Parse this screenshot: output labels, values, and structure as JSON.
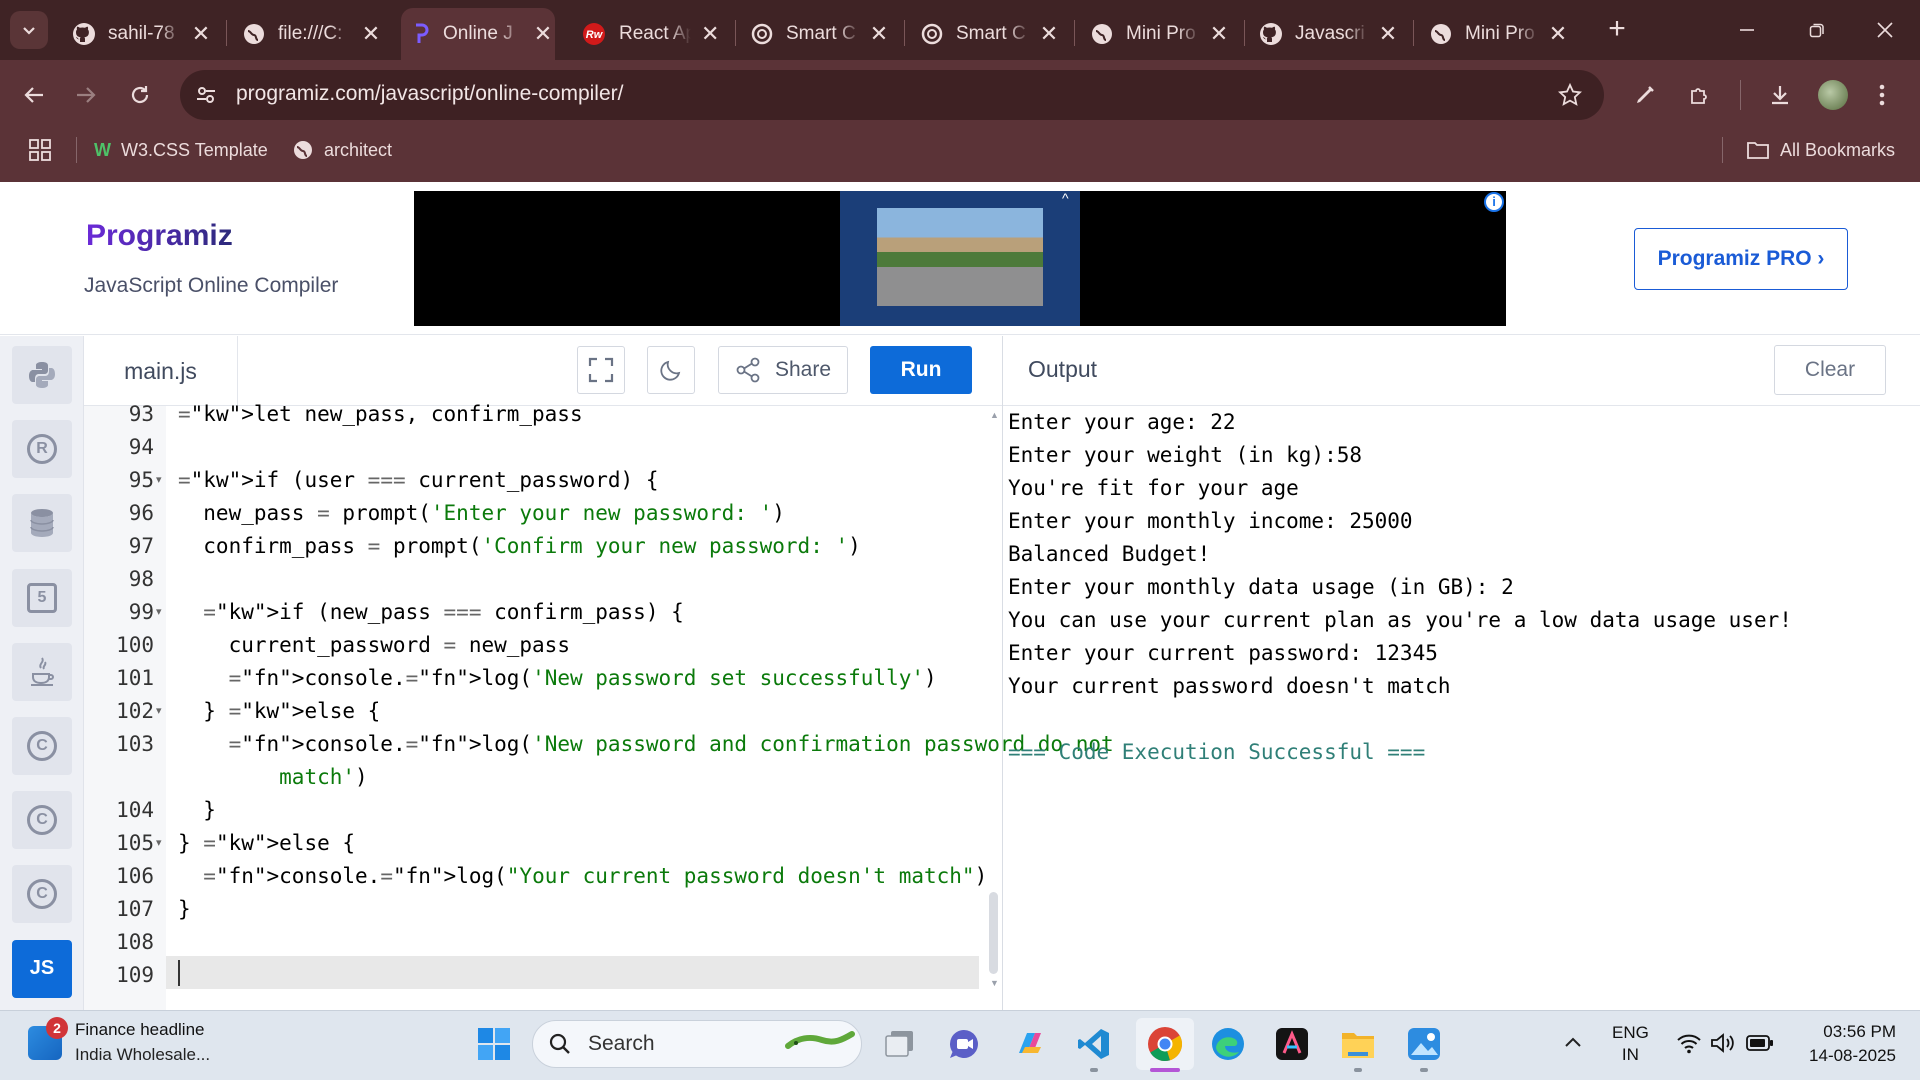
{
  "browser": {
    "tabs": [
      {
        "label": "sahil-78",
        "icon": "github-icon"
      },
      {
        "label": "file:///C:",
        "icon": "globe-icon"
      },
      {
        "label": "Online J",
        "icon": "programiz-icon"
      },
      {
        "label": "React Ap",
        "icon": "react-icon"
      },
      {
        "label": "Smart C",
        "icon": "openai-icon"
      },
      {
        "label": "Smart C",
        "icon": "openai-icon"
      },
      {
        "label": "Mini Pro",
        "icon": "globe-icon"
      },
      {
        "label": "Javascri",
        "icon": "github-icon"
      },
      {
        "label": "Mini Pro",
        "icon": "globe-icon"
      }
    ],
    "close_glyph": "✕",
    "new_tab_glyph": "+",
    "url": "programiz.com/javascript/online-compiler/",
    "bookmarks": [
      {
        "label": "W3.CSS Template"
      },
      {
        "label": "architect"
      }
    ],
    "all_bookmarks": "All Bookmarks"
  },
  "site": {
    "logo_text": "Programiz",
    "subtitle": "JavaScript Online Compiler",
    "pro_button": "Programiz PRO ›"
  },
  "languages": [
    {
      "name": "python-icon",
      "text": ""
    },
    {
      "name": "r-icon",
      "text": "R"
    },
    {
      "name": "sql-icon",
      "text": ""
    },
    {
      "name": "html5-icon",
      "text": "5"
    },
    {
      "name": "java-icon",
      "text": ""
    },
    {
      "name": "c-icon",
      "text": "C"
    },
    {
      "name": "cpp-icon",
      "text": "C"
    },
    {
      "name": "csharp-icon",
      "text": "C"
    },
    {
      "name": "js-icon",
      "text": "JS"
    }
  ],
  "editor": {
    "file_name": "main.js",
    "share_label": "Share",
    "run_label": "Run",
    "lines": [
      {
        "n": "93",
        "fold": false,
        "code": "let new_pass, confirm_pass"
      },
      {
        "n": "94",
        "fold": false,
        "code": ""
      },
      {
        "n": "95",
        "fold": true,
        "code": "if (user === current_password) {"
      },
      {
        "n": "96",
        "fold": false,
        "code": "  new_pass = prompt('Enter your new password: ')"
      },
      {
        "n": "97",
        "fold": false,
        "code": "  confirm_pass = prompt('Confirm your new password: ')"
      },
      {
        "n": "98",
        "fold": false,
        "code": ""
      },
      {
        "n": "99",
        "fold": true,
        "code": "  if (new_pass === confirm_pass) {"
      },
      {
        "n": "100",
        "fold": false,
        "code": "    current_password = new_pass"
      },
      {
        "n": "101",
        "fold": false,
        "code": "    console.log('New password set successfully')"
      },
      {
        "n": "102",
        "fold": true,
        "code": "  } else {"
      },
      {
        "n": "103",
        "fold": false,
        "code": "    console.log('New password and confirmation password do not"
      },
      {
        "n": "",
        "fold": false,
        "code": "        match')"
      },
      {
        "n": "104",
        "fold": false,
        "code": "  }"
      },
      {
        "n": "105",
        "fold": true,
        "code": "} else {"
      },
      {
        "n": "106",
        "fold": false,
        "code": "  console.log(\"Your current password doesn't match\")"
      },
      {
        "n": "107",
        "fold": false,
        "code": "}"
      },
      {
        "n": "108",
        "fold": false,
        "code": ""
      },
      {
        "n": "109",
        "fold": false,
        "code": ""
      }
    ]
  },
  "output": {
    "title": "Output",
    "clear_label": "Clear",
    "lines": [
      "Enter your age: 22",
      "Enter your weight (in kg):58",
      "You're fit for your age",
      "Enter your monthly income: 25000",
      "Balanced Budget!",
      "Enter your monthly data usage (in GB): 2",
      "You can use your current plan as you're a low data usage user!",
      "Enter your current password: 12345",
      "Your current password doesn't match",
      "",
      "=== Code Execution Successful ==="
    ]
  },
  "taskbar": {
    "news_badge": "2",
    "news_title": "Finance headline",
    "news_sub": "India Wholesale...",
    "search_label": "Search",
    "lang_line1": "ENG",
    "lang_line2": "IN",
    "time": "03:56 PM",
    "date": "14-08-2025"
  },
  "colors": {
    "run_button": "#0d6bd9",
    "success_text": "#2f7f77",
    "string_token": "#0b7a0b",
    "keyword_token": "#0000cc"
  }
}
